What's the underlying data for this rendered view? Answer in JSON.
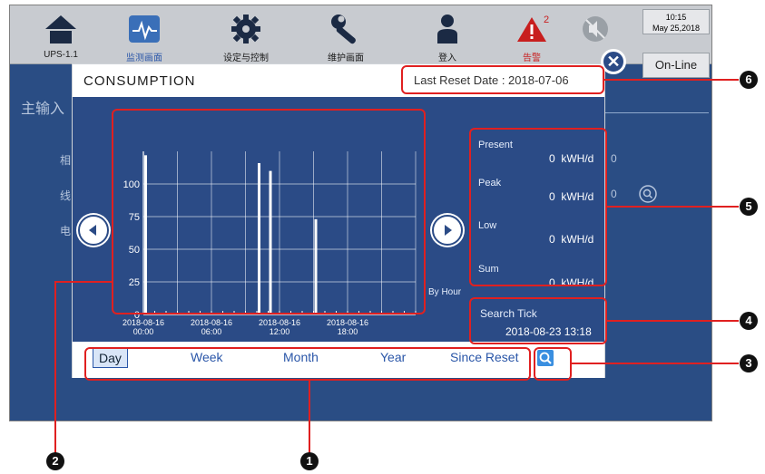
{
  "topbar": {
    "items": [
      {
        "label": "UPS-1.1"
      },
      {
        "label": "监测画面"
      },
      {
        "label": "设定与控制"
      },
      {
        "label": "维护画面"
      },
      {
        "label": "登入"
      },
      {
        "label": "告警"
      },
      {
        "label": ""
      }
    ],
    "alarm_count": "2",
    "clock_time": "10:15",
    "clock_date": "May 25,2018",
    "status": "On-Line"
  },
  "background": {
    "title": "主输入",
    "chars": [
      "相",
      "线",
      "电"
    ],
    "values": [
      "0",
      "0"
    ]
  },
  "dialog": {
    "title": "CONSUMPTION",
    "last_reset": "Last Reset Date : 2018-07-06",
    "by_hour": "By Hour",
    "readings": [
      {
        "name": "Present",
        "value": "0",
        "unit": "kWH/d"
      },
      {
        "name": "Peak",
        "value": "0",
        "unit": "kWH/d"
      },
      {
        "name": "Low",
        "value": "0",
        "unit": "kWH/d"
      },
      {
        "name": "Sum",
        "value": "0",
        "unit": "kWH/d"
      }
    ],
    "search_tick_label": "Search Tick",
    "search_tick_value": "2018-08-23 13:18",
    "tabs": [
      "Day",
      "Week",
      "Month",
      "Year",
      "Since Reset"
    ],
    "active_tab": "Day"
  },
  "callouts": [
    "1",
    "2",
    "3",
    "4",
    "5",
    "6"
  ],
  "colors": {
    "panel": "#2b4b86",
    "screen": "#2a4d84",
    "highlight": "#e02020",
    "tab_text": "#2a56a8"
  },
  "chart_data": {
    "type": "bar",
    "x": [
      "2018-08-16 00:00",
      "2018-08-16 06:00",
      "2018-08-16 12:00",
      "2018-08-16 18:00"
    ],
    "x_tick_labels": [
      [
        "2018-08-16",
        "00:00"
      ],
      [
        "2018-08-16",
        "06:00"
      ],
      [
        "2018-08-16",
        "12:00"
      ],
      [
        "2018-08-16",
        "18:00"
      ]
    ],
    "y_ticks": [
      0,
      25,
      50,
      75,
      100
    ],
    "ylim": [
      0,
      125
    ],
    "xlim_hours": [
      0,
      24
    ],
    "bars": [
      {
        "hour": 0.0,
        "value": 122
      },
      {
        "hour": 10.0,
        "value": 116
      },
      {
        "hour": 11.0,
        "value": 110
      },
      {
        "hour": 15.0,
        "value": 73
      }
    ],
    "grid": true,
    "title": "",
    "xlabel": "",
    "ylabel": ""
  }
}
